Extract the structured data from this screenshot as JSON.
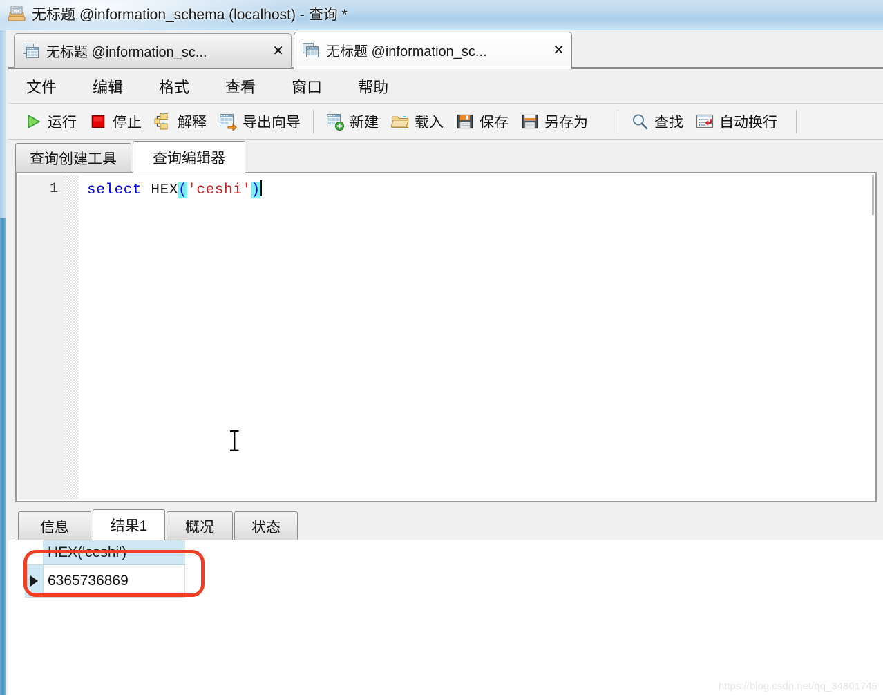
{
  "window": {
    "title": "无标题 @information_schema (localhost) - 查询 *",
    "icon": "query-window-icon"
  },
  "document_tabs": [
    {
      "label": "无标题 @information_sc...",
      "icon": "table-icon",
      "close": "✕",
      "active": false
    },
    {
      "label": "无标题 @information_sc...",
      "icon": "table-icon",
      "close": "✕",
      "active": true
    }
  ],
  "menubar": {
    "items": [
      {
        "label": "文件",
        "name": "menu-file"
      },
      {
        "label": "编辑",
        "name": "menu-edit"
      },
      {
        "label": "格式",
        "name": "menu-format"
      },
      {
        "label": "查看",
        "name": "menu-view"
      },
      {
        "label": "窗口",
        "name": "menu-window"
      },
      {
        "label": "帮助",
        "name": "menu-help"
      }
    ]
  },
  "toolbar": {
    "groups": [
      [
        {
          "label": "运行",
          "icon": "play-icon",
          "name": "run-button"
        },
        {
          "label": "停止",
          "icon": "stop-icon",
          "name": "stop-button"
        },
        {
          "label": "解释",
          "icon": "explain-icon",
          "name": "explain-button"
        },
        {
          "label": "导出向导",
          "icon": "export-wizard-icon",
          "name": "export-wizard-button"
        }
      ],
      [
        {
          "label": "新建",
          "icon": "new-query-icon",
          "name": "new-button"
        },
        {
          "label": "载入",
          "icon": "open-folder-icon",
          "name": "load-button"
        },
        {
          "label": "保存",
          "icon": "save-disk-icon",
          "name": "save-button"
        },
        {
          "label": "另存为",
          "icon": "save-as-icon",
          "name": "save-as-button"
        }
      ],
      [
        {
          "label": "查找",
          "icon": "search-icon",
          "name": "find-button"
        },
        {
          "label": "自动换行",
          "icon": "word-wrap-icon",
          "name": "word-wrap-button"
        }
      ]
    ]
  },
  "subtabs": [
    {
      "label": "查询创建工具",
      "active": false,
      "name": "tab-query-builder"
    },
    {
      "label": "查询编辑器",
      "active": true,
      "name": "tab-query-editor"
    }
  ],
  "editor": {
    "line_number": "1",
    "tokens": {
      "keyword": "select",
      "space1": " ",
      "function": "HEX",
      "paren_open": "(",
      "string": "'ceshi'",
      "paren_close": ")"
    },
    "full_text": "select HEX('ceshi')",
    "colors": {
      "keyword": "#0000ee",
      "string": "#cc2222",
      "paren_highlight": "#7ff0f0"
    }
  },
  "result_tabs": [
    {
      "label": "信息",
      "active": false,
      "name": "tab-info"
    },
    {
      "label": "结果1",
      "active": true,
      "name": "tab-result1"
    },
    {
      "label": "概况",
      "active": false,
      "name": "tab-profile"
    },
    {
      "label": "状态",
      "active": false,
      "name": "tab-status"
    }
  ],
  "result_grid": {
    "columns": [
      "HEX('ceshi')"
    ],
    "rows": [
      {
        "marker": "▶",
        "values": [
          "6365736869"
        ]
      }
    ]
  },
  "annotation": {
    "type": "red-rounded-rectangle",
    "color": "#ef3e23"
  },
  "watermark": "https://blog.csdn.net/qq_34801745"
}
